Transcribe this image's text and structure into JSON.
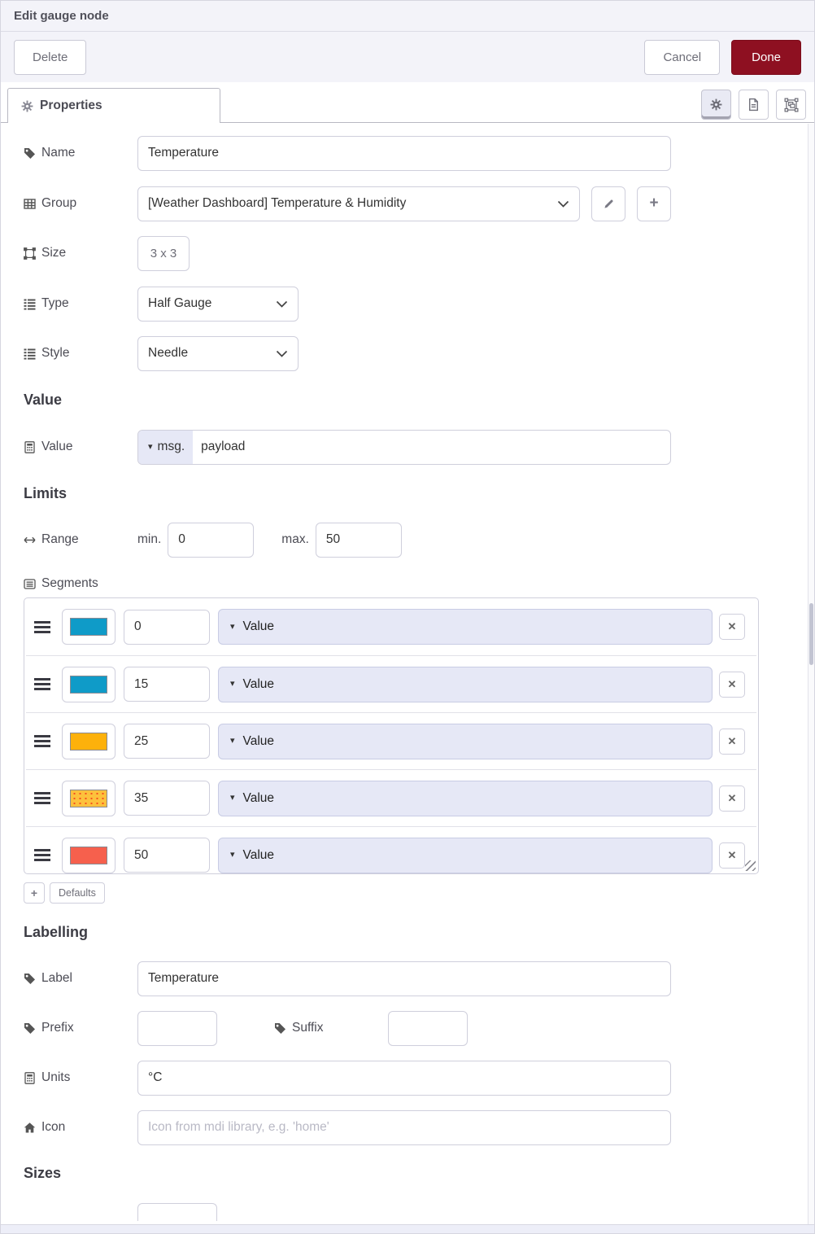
{
  "dialog": {
    "title": "Edit gauge node"
  },
  "toolbar": {
    "delete_label": "Delete",
    "cancel_label": "Cancel",
    "done_label": "Done"
  },
  "tabs": {
    "properties_label": "Properties"
  },
  "colors": {
    "accent": "#8e1021"
  },
  "icons": {
    "caret_down": "▾",
    "close_glyph": "✕",
    "plus_glyph": "+"
  },
  "sections": {
    "value": "Value",
    "limits": "Limits",
    "labelling": "Labelling",
    "sizes": "Sizes"
  },
  "fields": {
    "name": {
      "label": "Name",
      "value": "Temperature"
    },
    "group": {
      "label": "Group",
      "value": "[Weather Dashboard] Temperature & Humidity"
    },
    "size": {
      "label": "Size",
      "value": "3 x 3"
    },
    "type": {
      "label": "Type",
      "value": "Half Gauge"
    },
    "style": {
      "label": "Style",
      "value": "Needle"
    },
    "value": {
      "label": "Value",
      "prefix": "msg.",
      "path": "payload"
    },
    "range": {
      "label": "Range",
      "min_label": "min.",
      "min": "0",
      "max_label": "max.",
      "max": "50"
    },
    "segments": {
      "label": "Segments",
      "defaults_label": "Defaults",
      "rows": [
        {
          "color": "#0f9bc8",
          "value": "0",
          "option": "Value"
        },
        {
          "color": "#0f9bc8",
          "value": "15",
          "option": "Value"
        },
        {
          "color": "#fdb10b",
          "value": "25",
          "option": "Value"
        },
        {
          "color": "#fdc13c",
          "value": "35",
          "option": "Value"
        },
        {
          "color": "#f6604d",
          "value": "50",
          "option": "Value"
        }
      ]
    },
    "label": {
      "label": "Label",
      "value": "Temperature"
    },
    "prefix": {
      "label": "Prefix",
      "value": ""
    },
    "suffix": {
      "label": "Suffix",
      "value": ""
    },
    "units": {
      "label": "Units",
      "value": "°C"
    },
    "icon": {
      "label": "Icon",
      "placeholder": "Icon from mdi library, e.g. 'home'"
    }
  }
}
